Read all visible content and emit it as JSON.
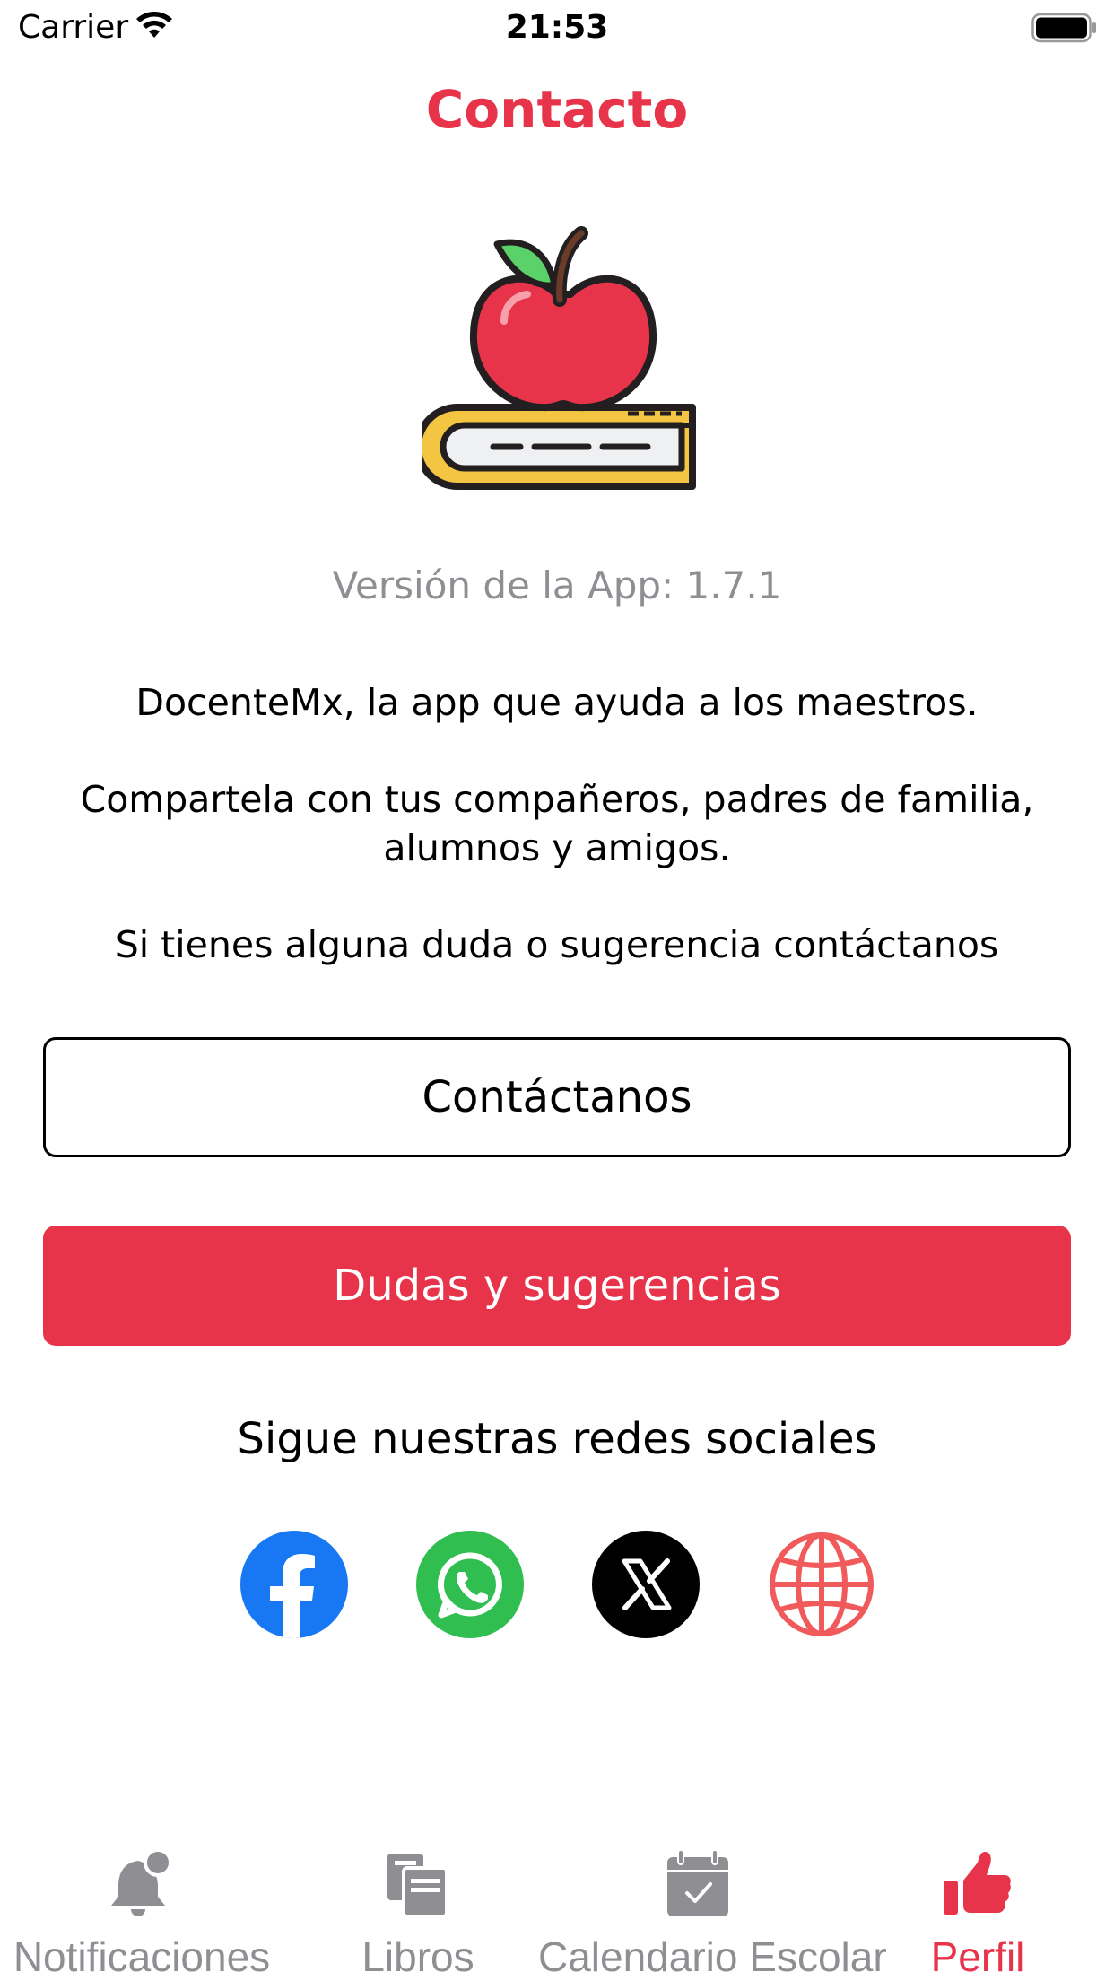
{
  "status_bar": {
    "carrier": "Carrier",
    "time": "21:53"
  },
  "header": {
    "title": "Contacto"
  },
  "app": {
    "version": "Versión de la App: 1.7.1",
    "description_1": "DocenteMx, la app que ayuda a los maestros.",
    "description_2": "Compartela con tus compañeros, padres de familia, alumnos y amigos.",
    "description_3": "Si tienes alguna duda o sugerencia contáctanos"
  },
  "buttons": {
    "contact": "Contáctanos",
    "feedback": "Dudas y sugerencias"
  },
  "social": {
    "title": "Sigue nuestras redes sociales",
    "items": [
      "facebook-icon",
      "whatsapp-icon",
      "x-icon",
      "globe-icon"
    ]
  },
  "tabbar": {
    "items": [
      {
        "label": "Notificaciones",
        "icon": "bell-icon",
        "active": false
      },
      {
        "label": "Libros",
        "icon": "books-icon",
        "active": false
      },
      {
        "label": "Calendario Escolar",
        "icon": "calendar-icon",
        "active": false
      },
      {
        "label": "Perfil",
        "icon": "thumbs-up-icon",
        "active": true
      }
    ]
  },
  "colors": {
    "accent": "#e8344a",
    "inactive": "#8e8e93",
    "facebook": "#1877f2",
    "whatsapp": "#2fbe4f",
    "web": "#f05a5a"
  }
}
